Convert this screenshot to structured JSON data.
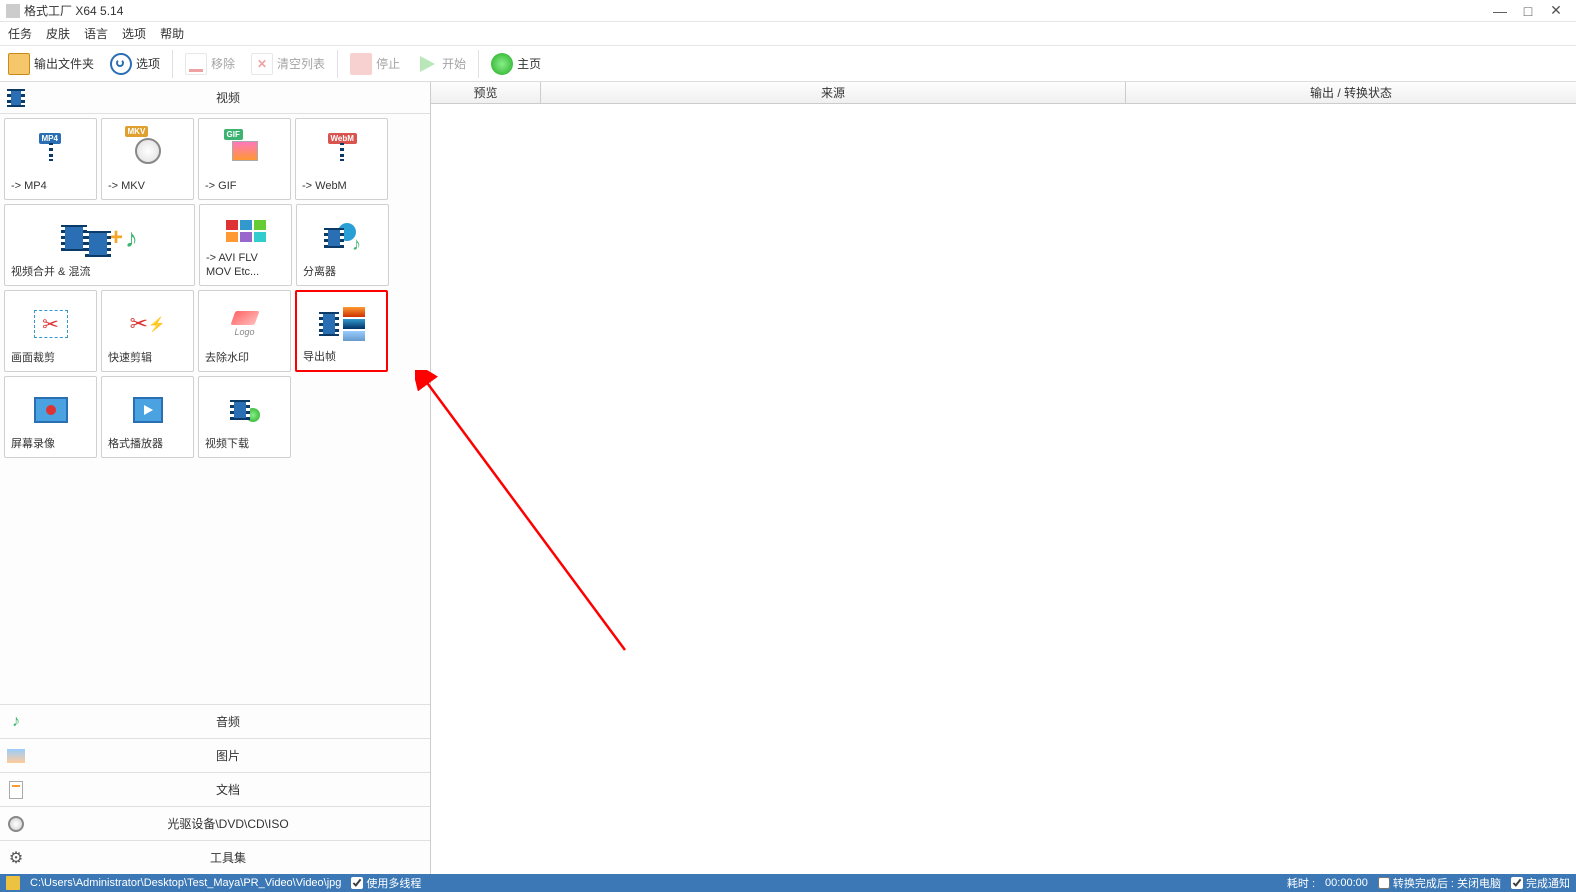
{
  "window": {
    "title": "格式工厂 X64 5.14"
  },
  "menubar": [
    "任务",
    "皮肤",
    "语言",
    "选项",
    "帮助"
  ],
  "toolbar": {
    "output_folder": "输出文件夹",
    "options": "选项",
    "remove": "移除",
    "clear_list": "清空列表",
    "stop": "停止",
    "start": "开始",
    "home": "主页"
  },
  "categories": {
    "video": "视频",
    "audio": "音频",
    "image": "图片",
    "document": "文档",
    "optical": "光驱设备\\DVD\\CD\\ISO",
    "toolset": "工具集"
  },
  "tiles": {
    "mp4": "-> MP4",
    "mkv": "-> MKV",
    "gif": "-> GIF",
    "webm": "-> WebM",
    "merge": "视频合并 & 混流",
    "avi_etc": "-> AVI FLV MOV Etc...",
    "splitter": "分离器",
    "crop": "画面裁剪",
    "fast_clip": "快速剪辑",
    "remove_wm": "去除水印",
    "export_frame": "导出帧",
    "screen_rec": "屏幕录像",
    "player": "格式播放器",
    "download": "视频下载"
  },
  "columns": {
    "preview": "预览",
    "source": "来源",
    "output_status": "输出 / 转换状态"
  },
  "status": {
    "path": "C:\\Users\\Administrator\\Desktop\\Test_Maya\\PR_Video\\Video\\jpg",
    "multithread": "使用多线程",
    "elapsed_label": "耗时 :",
    "elapsed_value": "00:00:00",
    "after_convert": "转换完成后 :",
    "shutdown": "关闭电脑",
    "notify": "完成通知"
  }
}
